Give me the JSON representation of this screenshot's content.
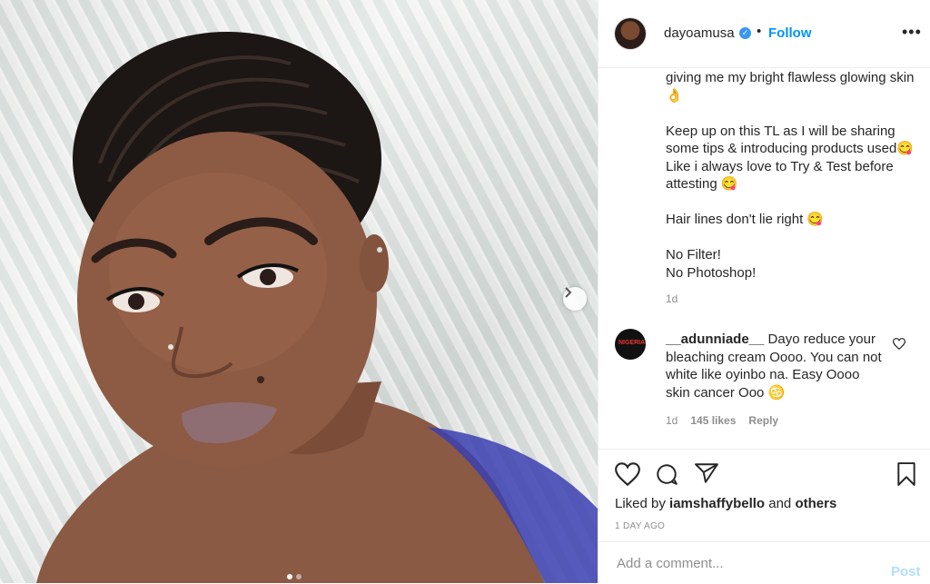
{
  "post": {
    "username": "dayoamusa",
    "verified_mark": "✓",
    "separator": "•",
    "follow_label": "Follow",
    "more_label": "•••",
    "caption": [
      "giving me my bright flawless glowing skin 👌",
      "Keep up on this TL as I will be sharing some tips & introducing products used😋 Like i always love to Try & Test before attesting 😋",
      "Hair lines don't lie right 😋",
      "No Filter!\nNo Photoshop!"
    ],
    "caption_time": "1d",
    "next_icon": "chevron-right-icon"
  },
  "comment": {
    "username": "__adunniade__",
    "text": " Dayo reduce your bleaching cream Oooo. You can not white like oyinbo na. Easy Oooo skin cancer Ooo ♋",
    "avatar_text": "NIGERIA",
    "time": "1d",
    "likes": "145 likes",
    "reply_label": "Reply"
  },
  "actions": {
    "icons": [
      "heart-icon",
      "comment-icon",
      "share-icon",
      "bookmark-icon"
    ]
  },
  "likes_line": {
    "prefix": "Liked by ",
    "user": "iamshaffybello",
    "middle": " and ",
    "others": "others"
  },
  "date": "1 DAY AGO",
  "add_comment": {
    "placeholder": "Add a comment...",
    "post_label": "Post"
  },
  "colors": {
    "link_blue": "#0095f6",
    "verified_blue": "#3897f0",
    "muted": "#8e8e8e"
  }
}
